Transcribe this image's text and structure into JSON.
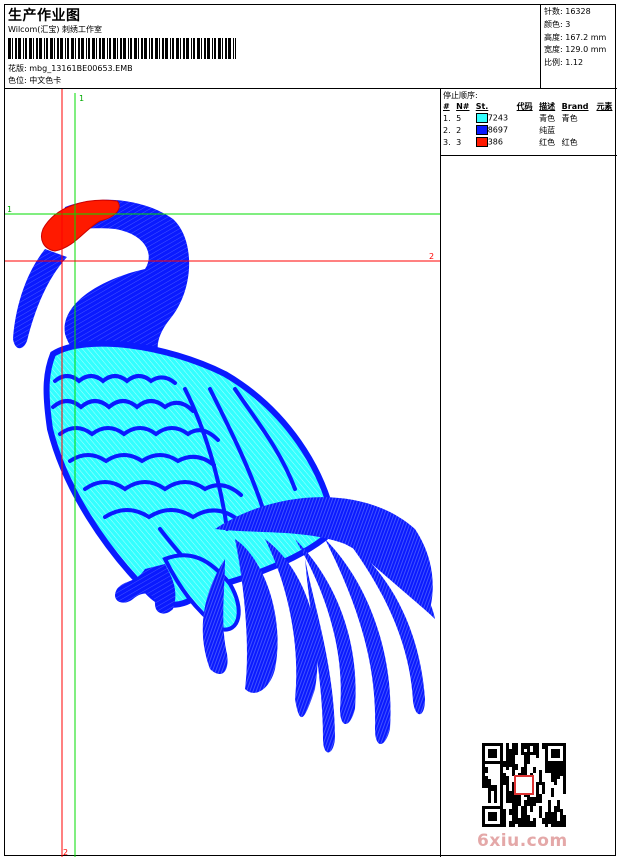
{
  "header": {
    "title": "生产作业图",
    "company": "Wilcom(汇宝) 刺绣工作室",
    "design_label": "花版:",
    "design_file": "mbg_13161BE00653.EMB",
    "colorset_label": "色位:",
    "colorset_value": "中文色卡"
  },
  "stats": [
    {
      "label": "针数:",
      "value": "16328"
    },
    {
      "label": "颜色:",
      "value": "3"
    },
    {
      "label": "高度:",
      "value": "167.2 mm"
    },
    {
      "label": "宽度:",
      "value": "129.0 mm"
    },
    {
      "label": "比例:",
      "value": "1.12"
    }
  ],
  "stop_sequence": {
    "title": "停止顺序:",
    "columns": [
      "#",
      "N#",
      "St.",
      "代码",
      "描述",
      "Brand",
      "元素"
    ],
    "rows": [
      {
        "num": "1.",
        "needle": "5",
        "color": "#33ffff",
        "stitches": "7243",
        "code": "",
        "desc": "青色",
        "brand": "青色"
      },
      {
        "num": "2.",
        "needle": "2",
        "color": "#0a1aff",
        "stitches": "8697",
        "code": "",
        "desc": "纯蓝",
        "brand": ""
      },
      {
        "num": "3.",
        "needle": "3",
        "color": "#ff1a00",
        "stitches": "386",
        "code": "",
        "desc": "红色",
        "brand": "红色"
      }
    ]
  },
  "guides": {
    "green_v": "1",
    "green_h": "1",
    "red_h": "2",
    "red_v": "2"
  },
  "colors": {
    "cyan": "#33ffff",
    "blue": "#0a1aff",
    "red": "#ff1a00",
    "green_guide": "#00dd00",
    "red_guide": "#ff0000"
  },
  "watermark": "6xiu.com"
}
